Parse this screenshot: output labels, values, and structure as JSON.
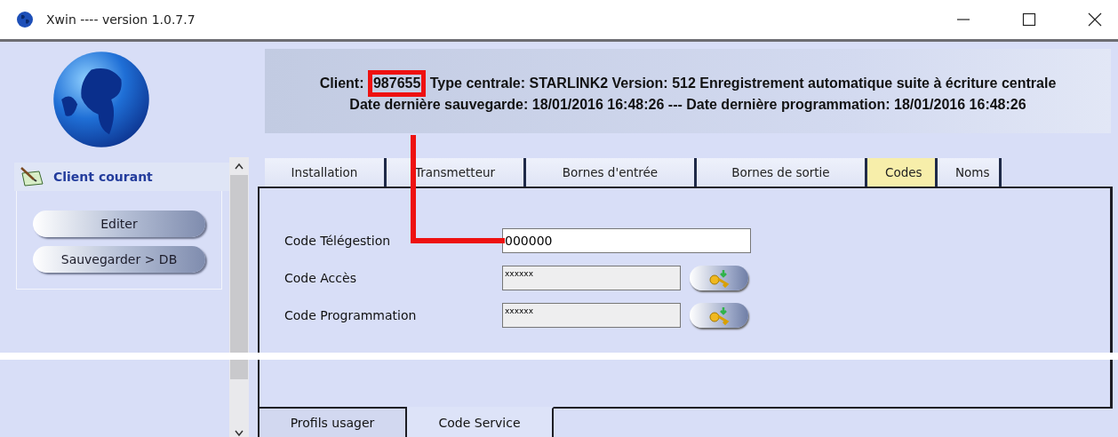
{
  "window": {
    "title": "Xwin ---- version 1.0.7.7"
  },
  "header": {
    "client_label": "Client:",
    "client_number": "987655",
    "client_number_highlighted": true,
    "line_1": "Type centrale: STARLINK2 Version: 512   Enregistrement automatique suite à écriture centrale",
    "line_2": "Date dernière sauvegarde: 18/01/2016 16:48:26   ---   Date dernière programmation: 18/01/2016 16:48:26"
  },
  "sidebar": {
    "section_title": "Client courant",
    "buttons": [
      "Editer",
      "Sauvegarder > DB"
    ]
  },
  "tabs": [
    {
      "label": "Installation",
      "selected": false
    },
    {
      "label": "Transmetteur",
      "selected": false
    },
    {
      "label": "Bornes d'entrée",
      "selected": false
    },
    {
      "label": "Bornes de sortie",
      "selected": false
    },
    {
      "label": "Codes",
      "selected": true
    },
    {
      "label": "Noms",
      "selected": false
    }
  ],
  "fields": [
    {
      "label": "Code Télégestion",
      "value": "000000",
      "kind": "text"
    },
    {
      "label": "Code Accès",
      "value": "xxxxxx",
      "kind": "masked"
    },
    {
      "label": "Code Programmation",
      "value": "xxxxxx",
      "kind": "masked"
    }
  ],
  "bottom_tabs": [
    {
      "label": "Profils usager",
      "selected": false
    },
    {
      "label": "Code Service",
      "selected": true
    }
  ]
}
